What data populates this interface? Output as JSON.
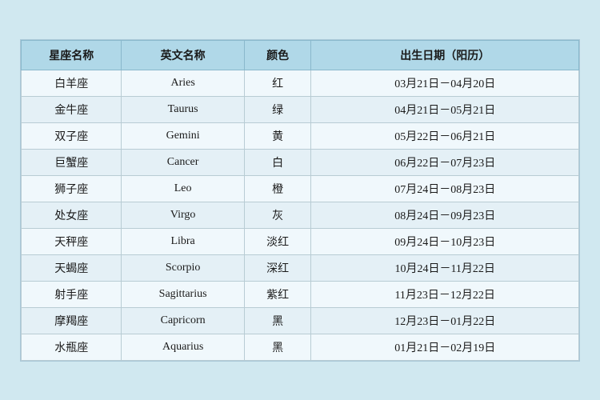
{
  "table": {
    "headers": {
      "name": "星座名称",
      "english": "英文名称",
      "color": "颜色",
      "date": "出生日期（阳历）"
    },
    "rows": [
      {
        "name": "白羊座",
        "english": "Aries",
        "color": "红",
        "date": "03月21日－04月20日"
      },
      {
        "name": "金牛座",
        "english": "Taurus",
        "color": "绿",
        "date": "04月21日－05月21日"
      },
      {
        "name": "双子座",
        "english": "Gemini",
        "color": "黄",
        "date": "05月22日－06月21日"
      },
      {
        "name": "巨蟹座",
        "english": "Cancer",
        "color": "白",
        "date": "06月22日－07月23日"
      },
      {
        "name": "狮子座",
        "english": "Leo",
        "color": "橙",
        "date": "07月24日－08月23日"
      },
      {
        "name": "处女座",
        "english": "Virgo",
        "color": "灰",
        "date": "08月24日－09月23日"
      },
      {
        "name": "天秤座",
        "english": "Libra",
        "color": "淡红",
        "date": "09月24日－10月23日"
      },
      {
        "name": "天蝎座",
        "english": "Scorpio",
        "color": "深红",
        "date": "10月24日－11月22日"
      },
      {
        "name": "射手座",
        "english": "Sagittarius",
        "color": "紫红",
        "date": "11月23日－12月22日"
      },
      {
        "name": "摩羯座",
        "english": "Capricorn",
        "color": "黑",
        "date": "12月23日－01月22日"
      },
      {
        "name": "水瓶座",
        "english": "Aquarius",
        "color": "黑",
        "date": "01月21日－02月19日"
      }
    ]
  }
}
